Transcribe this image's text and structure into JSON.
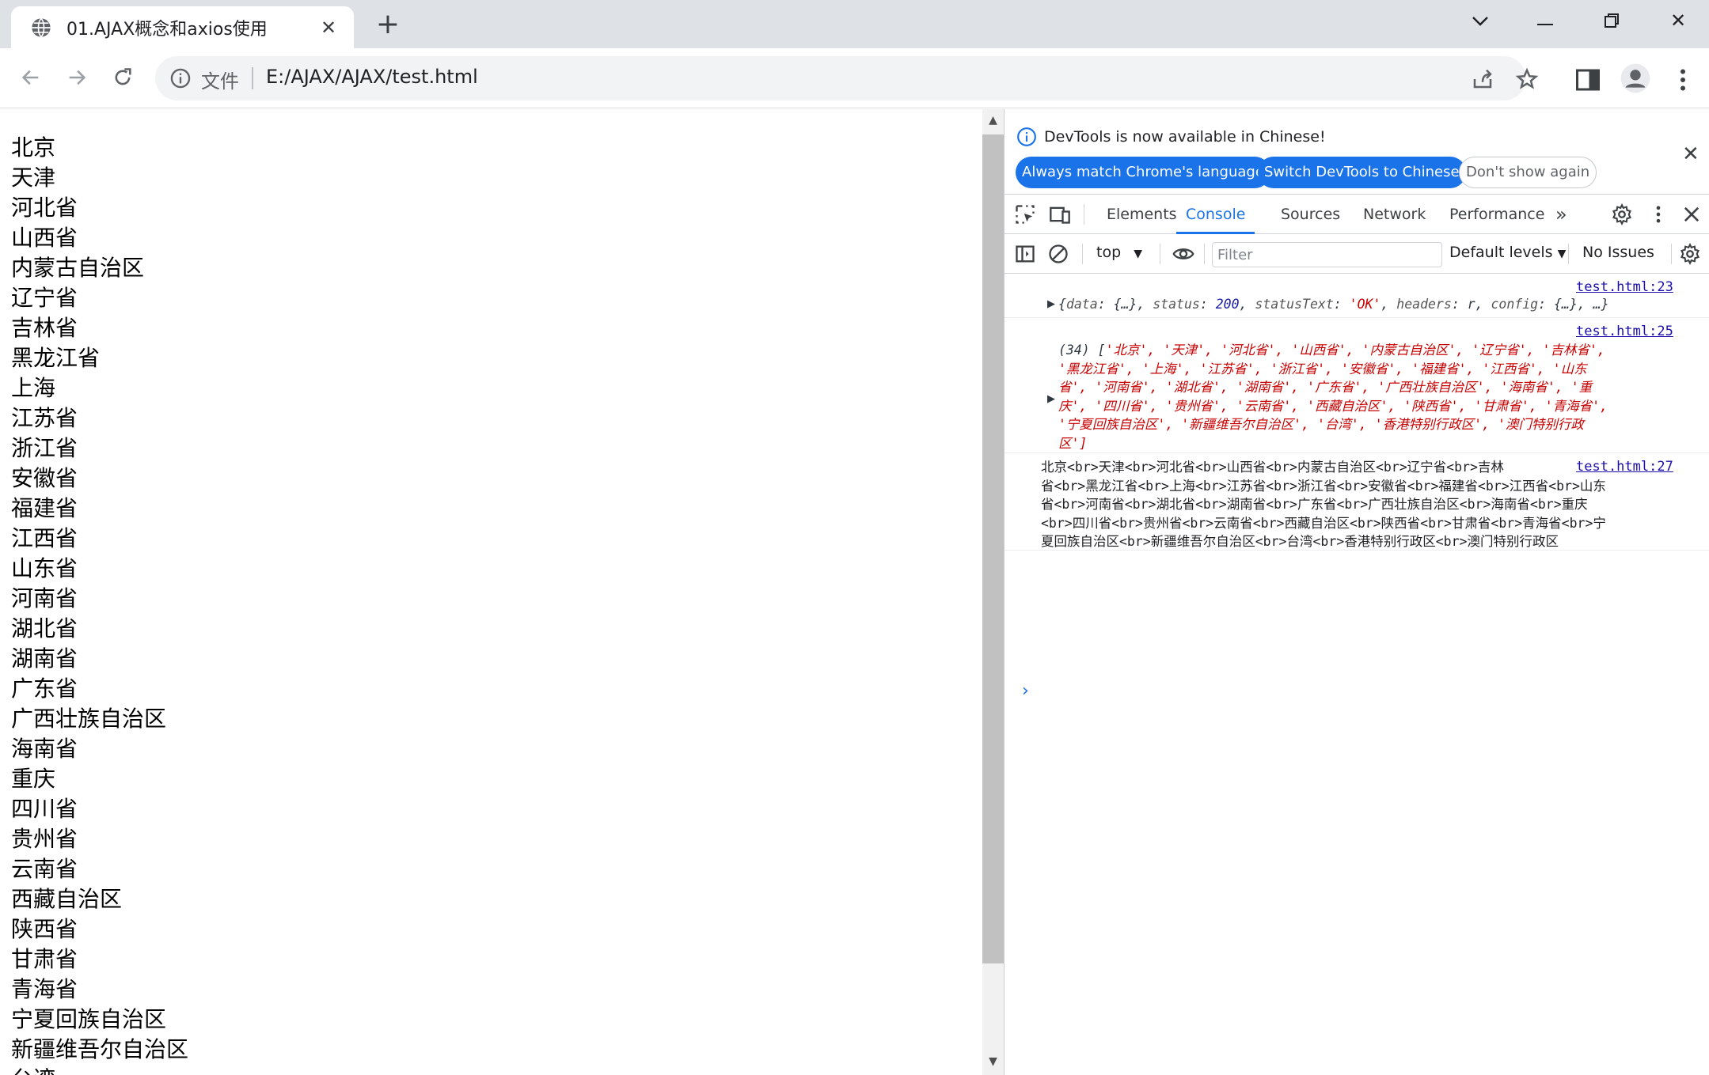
{
  "browser": {
    "tab_title": "01.AJAX概念和axios使用",
    "new_tab_label": "+",
    "omnibox": {
      "security_label": "文件",
      "url": "E:/AJAX/AJAX/test.html"
    }
  },
  "page": {
    "provinces": [
      "北京",
      "天津",
      "河北省",
      "山西省",
      "内蒙古自治区",
      "辽宁省",
      "吉林省",
      "黑龙江省",
      "上海",
      "江苏省",
      "浙江省",
      "安徽省",
      "福建省",
      "江西省",
      "山东省",
      "河南省",
      "湖北省",
      "湖南省",
      "广东省",
      "广西壮族自治区",
      "海南省",
      "重庆",
      "四川省",
      "贵州省",
      "云南省",
      "西藏自治区",
      "陕西省",
      "甘肃省",
      "青海省",
      "宁夏回族自治区",
      "新疆维吾尔自治区",
      "台湾"
    ]
  },
  "devtools": {
    "infobar": {
      "message": "DevTools is now available in Chinese!",
      "match_button": "Always match Chrome's language",
      "switch_button": "Switch DevTools to Chinese",
      "dismiss_button": "Don't show again"
    },
    "tabs": [
      "Elements",
      "Console",
      "Sources",
      "Network",
      "Performance"
    ],
    "active_tab": "Console",
    "more_tabs": "»",
    "console_toolbar": {
      "context": "top",
      "filter_placeholder": "Filter",
      "levels": "Default levels",
      "issues": "No Issues"
    },
    "messages": {
      "m1": {
        "source": "test.html:23",
        "prefix": "{",
        "k_data": "data",
        "v_data": "{…}",
        "k_status": "status",
        "v_status": "200",
        "k_statusText": "statusText",
        "v_statusText": "'OK'",
        "k_headers": "headers",
        "v_headers": "r",
        "k_config": "config",
        "v_config": "{…}",
        "suffix": "…}"
      },
      "m2": {
        "source": "test.html:25",
        "lines": [
          "(34) ['北京', '天津', '河北省', '山西省', '内蒙古自治区', '辽宁省', '吉林省',",
          "'黑龙江省', '上海', '江苏省', '浙江省', '安徽省', '福建省', '江西省', '山东",
          "省', '河南省', '湖北省', '湖南省', '广东省', '广西壮族自治区', '海南省', '重",
          "庆', '四川省', '贵州省', '云南省', '西藏自治区', '陕西省', '甘肃省', '青海省',",
          "'宁夏回族自治区', '新疆维吾尔自治区', '台湾', '香港特别行政区', '澳门特别行政",
          "区']"
        ]
      },
      "m3": {
        "source": "test.html:27",
        "lines": [
          "北京<br>天津<br>河北省<br>山西省<br>内蒙古自治区<br>辽宁省<br>吉林",
          "省<br>黑龙江省<br>上海<br>江苏省<br>浙江省<br>安徽省<br>福建省<br>江西省<br>山东",
          "省<br>河南省<br>湖北省<br>湖南省<br>广东省<br>广西壮族自治区<br>海南省<br>重庆",
          "<br>四川省<br>贵州省<br>云南省<br>西藏自治区<br>陕西省<br>甘肃省<br>青海省<br>宁",
          "夏回族自治区<br>新疆维吾尔自治区<br>台湾<br>香港特别行政区<br>澳门特别行政区"
        ]
      }
    },
    "prompt": "›"
  }
}
